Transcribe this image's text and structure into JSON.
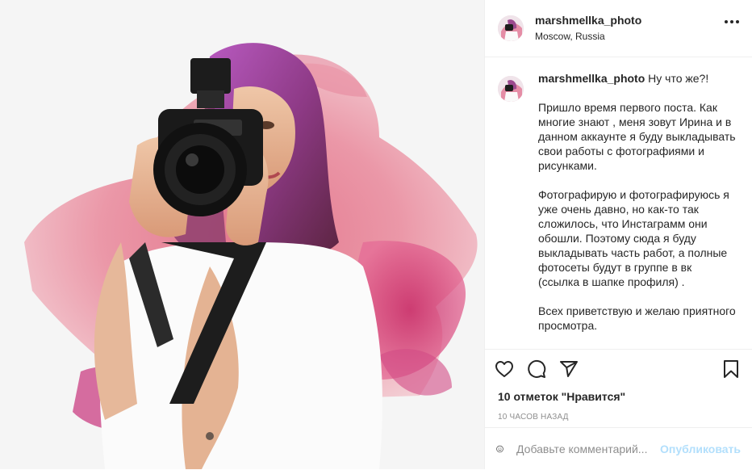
{
  "post": {
    "username": "marshmellka_photo",
    "location": "Moscow, Russia",
    "caption": {
      "username": "marshmellka_photo",
      "first_line": "Ну что же?!",
      "paragraphs": [
        "Пришло время первого поста. Как многие знают , меня зовут Ирина и в данном аккаунте я буду выкладывать свои работы с фотографиями и рисунками.",
        "Фотографирую и фотографируюсь я уже очень давно, но как-то так сложилось, что Инстаграмм они обошли. Поэтому сюда я буду выкладывать часть работ, а полные фотосеты будут в группе в вк (ссылка в шапке профиля) .",
        "Всех приветствую и желаю приятного просмотра."
      ]
    },
    "likes": "10 отметок \"Нравится\"",
    "time": "10 часов назад"
  },
  "comment": {
    "placeholder": "Добавьте комментарий...",
    "publish_label": "Опубликовать"
  },
  "icons": {
    "more": "more-options-icon",
    "like": "heart-icon",
    "comment": "comment-icon",
    "share": "share-icon",
    "save": "bookmark-icon",
    "emoji": "emoji-icon"
  },
  "colors": {
    "text": "#262626",
    "secondary": "#8e8e8e",
    "publish_disabled": "#b2dffc",
    "border": "#efefef"
  }
}
